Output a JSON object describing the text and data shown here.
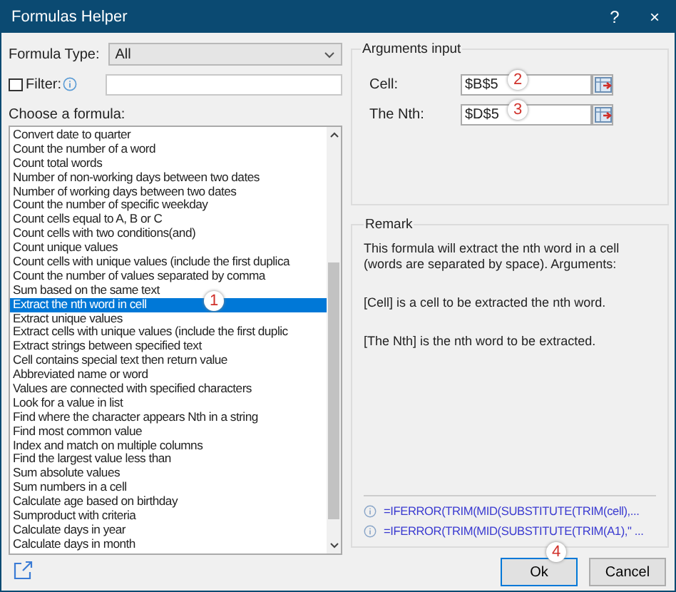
{
  "window": {
    "title": "Formulas Helper",
    "help_glyph": "?",
    "close_glyph": "×"
  },
  "formula_type": {
    "label": "Formula Type:",
    "value": "All"
  },
  "filter": {
    "label": "Filter:",
    "checked": false
  },
  "formula_list": {
    "label": "Choose a formula:",
    "items": [
      {
        "text": "Convert date to quarter",
        "selected": false
      },
      {
        "text": "Count the number of a word",
        "selected": false
      },
      {
        "text": "Count total words",
        "selected": false
      },
      {
        "text": "Number of non-working days between two dates",
        "selected": false
      },
      {
        "text": "Number of working days between two dates",
        "selected": false
      },
      {
        "text": "Count the number of specific weekday",
        "selected": false
      },
      {
        "text": "Count cells equal to A, B or C",
        "selected": false
      },
      {
        "text": "Count cells with two conditions(and)",
        "selected": false
      },
      {
        "text": "Count unique values",
        "selected": false
      },
      {
        "text": "Count cells with unique values (include the first duplica",
        "selected": false
      },
      {
        "text": "Count the number of values separated by comma",
        "selected": false
      },
      {
        "text": "Sum based on the same text",
        "selected": false
      },
      {
        "text": "Extract the nth word in cell",
        "selected": true,
        "callout": "1"
      },
      {
        "text": "Extract unique values",
        "selected": false
      },
      {
        "text": "Extract cells with unique values (include the first duplic",
        "selected": false
      },
      {
        "text": "Extract strings between specified text",
        "selected": false
      },
      {
        "text": "Cell contains special text then return value",
        "selected": false
      },
      {
        "text": "Abbreviated name or word",
        "selected": false
      },
      {
        "text": "Values are connected with specified characters",
        "selected": false
      },
      {
        "text": "Look for a value in list",
        "selected": false
      },
      {
        "text": "Find where the character appears Nth in a string",
        "selected": false
      },
      {
        "text": "Find most common value",
        "selected": false
      },
      {
        "text": "Index and match on multiple columns",
        "selected": false
      },
      {
        "text": "Find the largest value less than",
        "selected": false
      },
      {
        "text": "Sum absolute values",
        "selected": false
      },
      {
        "text": "Sum numbers in a cell",
        "selected": false
      },
      {
        "text": "Calculate age based on birthday",
        "selected": false
      },
      {
        "text": "Sumproduct with criteria",
        "selected": false
      },
      {
        "text": "Calculate days in year",
        "selected": false
      },
      {
        "text": "Calculate days in month",
        "selected": false
      }
    ]
  },
  "arguments": {
    "title": "Arguments input",
    "fields": [
      {
        "label": "Cell:",
        "value": "$B$5",
        "callout": "2"
      },
      {
        "label": "The Nth:",
        "value": "$D$5",
        "callout": "3"
      }
    ]
  },
  "remark": {
    "title": "Remark",
    "paragraphs": [
      "This formula will extract the nth word in a cell (words are separated by space). Arguments:",
      "[Cell] is a cell to be extracted the nth word.",
      "[The Nth] is the nth word to be extracted."
    ],
    "formulas": [
      "=IFERROR(TRIM(MID(SUBSTITUTE(TRIM(cell),...",
      "=IFERROR(TRIM(MID(SUBSTITUTE(TRIM(A1),\" ..."
    ]
  },
  "buttons": [
    {
      "label": "Ok",
      "kind": "primary",
      "callout": "4"
    },
    {
      "label": "Cancel",
      "kind": "normal"
    }
  ]
}
